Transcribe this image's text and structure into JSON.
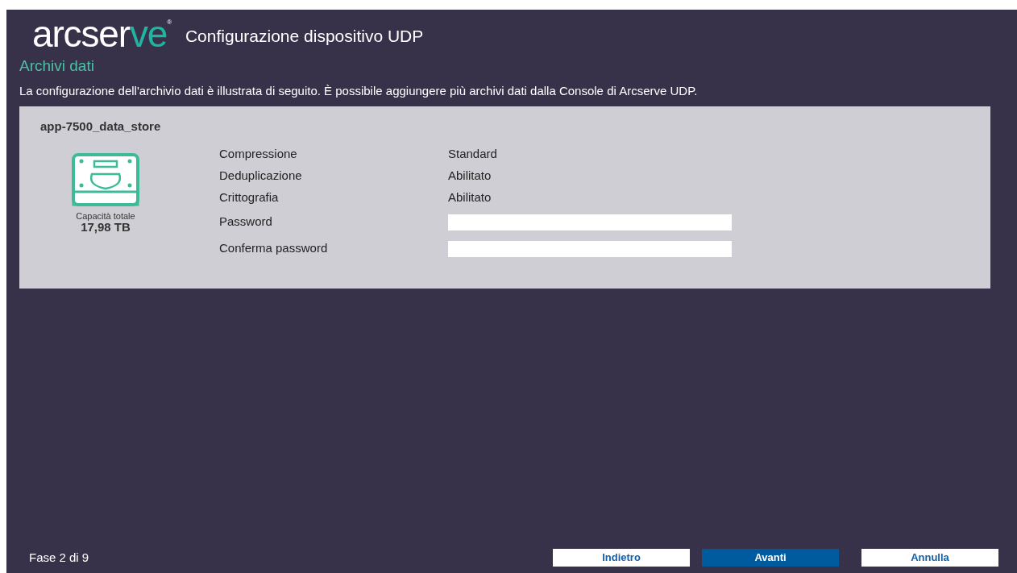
{
  "logo": {
    "main": "arcser",
    "accent": "ve",
    "mark": "®"
  },
  "window": {
    "title": "Configurazione dispositivo UDP"
  },
  "section": {
    "title": "Archivi dati",
    "description": "La configurazione dell'archivio dati è illustrata di seguito. È possibile aggiungere più archivi dati dalla Console di Arcserve UDP."
  },
  "data_store": {
    "name": "app-7500_data_store",
    "capacity_label": "Capacità totale",
    "capacity": "17,98 TB",
    "fields": [
      {
        "kind": "value",
        "label": "Compressione",
        "value": "Standard"
      },
      {
        "kind": "value",
        "label": "Deduplicazione",
        "value": "Abilitato"
      },
      {
        "kind": "value",
        "label": "Crittografia",
        "value": "Abilitato"
      },
      {
        "kind": "password",
        "label": "Password"
      },
      {
        "kind": "password",
        "label": "Conferma password"
      }
    ]
  },
  "footer": {
    "step": "Fase 2 di 9",
    "buttons": [
      {
        "label": "Indietro",
        "primary": false
      },
      {
        "label": "Avanti",
        "primary": true
      },
      {
        "label": "Annulla",
        "primary": false
      }
    ]
  }
}
